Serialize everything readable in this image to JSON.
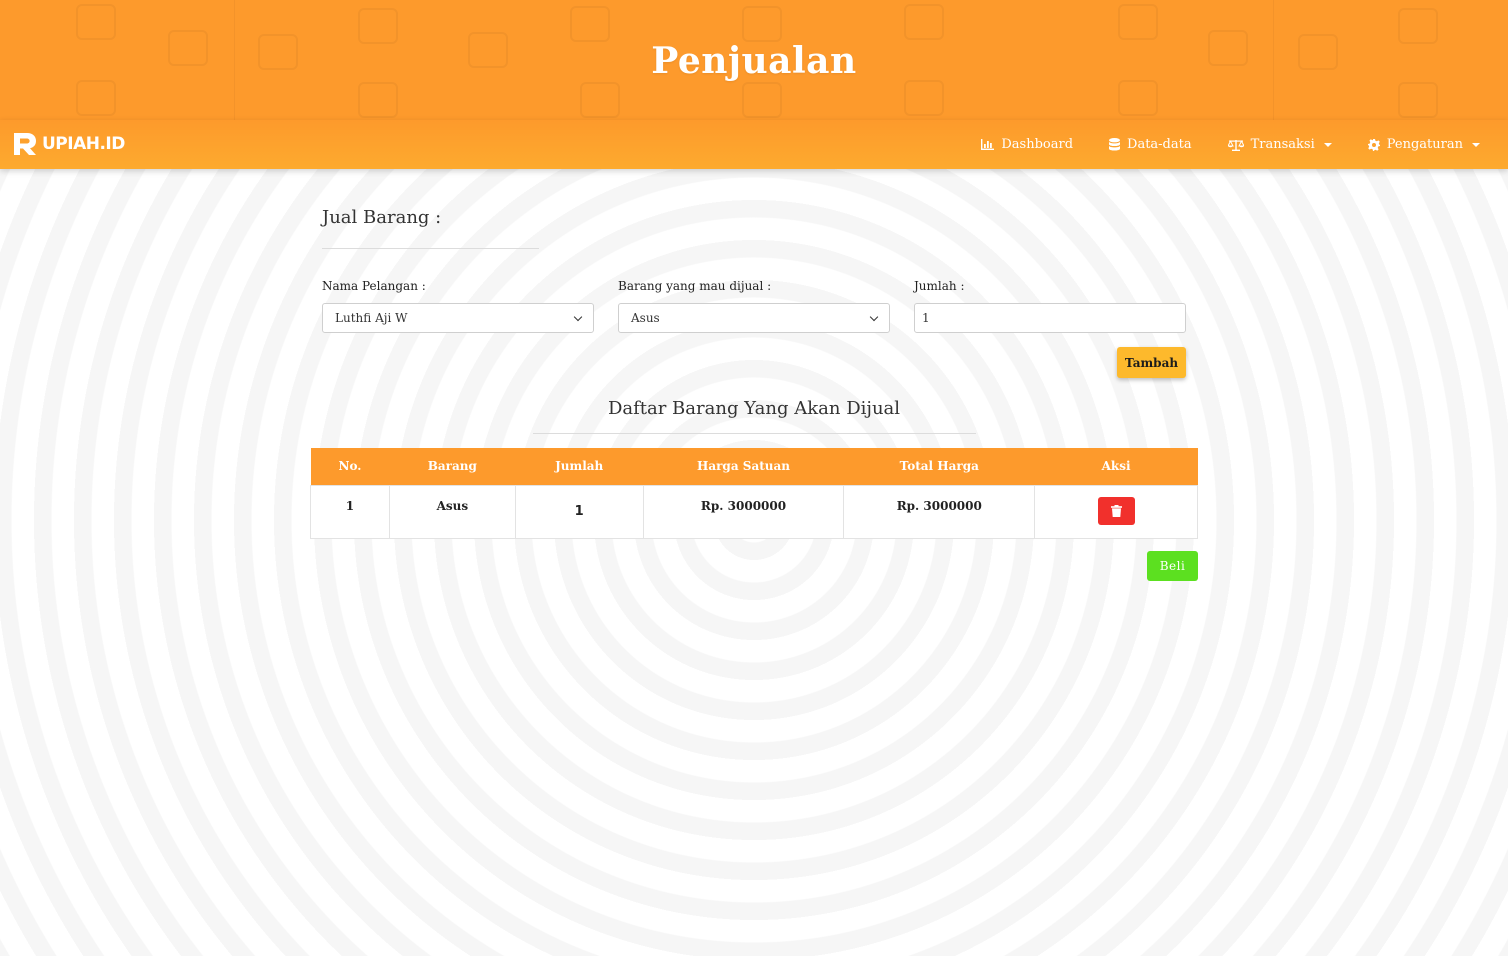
{
  "header": {
    "title": "Penjualan"
  },
  "navbar": {
    "brand": "UPIAH.ID",
    "items": [
      {
        "label": "Dashboard",
        "icon": "chart-icon",
        "dropdown": false
      },
      {
        "label": "Data-data",
        "icon": "database-icon",
        "dropdown": false
      },
      {
        "label": "Transaksi",
        "icon": "balance-scale-icon",
        "dropdown": true
      },
      {
        "label": "Pengaturan",
        "icon": "gear-icon",
        "dropdown": true
      }
    ]
  },
  "form": {
    "title": "Jual Barang :",
    "customer_label": "Nama Pelangan :",
    "customer_value": "Luthfi Aji W",
    "item_label": "Barang yang mau dijual :",
    "item_value": "Asus",
    "qty_label": "Jumlah :",
    "qty_value": "1",
    "add_button": "Tambah"
  },
  "list": {
    "title": "Daftar Barang Yang Akan Dijual",
    "columns": [
      "No.",
      "Barang",
      "Jumlah",
      "Harga Satuan",
      "Total Harga",
      "Aksi"
    ],
    "rows": [
      {
        "no": "1",
        "barang": "Asus",
        "jumlah": "1",
        "harga_satuan": "Rp. 3000000",
        "total_harga": "Rp. 3000000"
      }
    ],
    "buy_button": "Beli"
  },
  "colors": {
    "primary": "#fd9a2c",
    "warning": "#fdb92c",
    "danger": "#f1302c",
    "success": "#5ce020"
  }
}
